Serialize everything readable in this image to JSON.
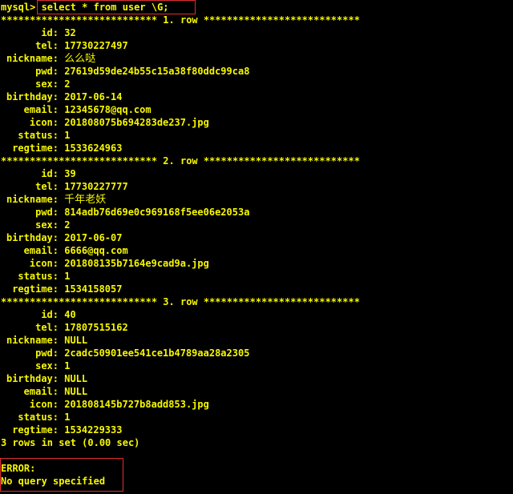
{
  "terminal": {
    "prompt": "mysql>",
    "command": " select * from user \\G;",
    "records": [
      {
        "separator": "*************************** 1. row ***************************",
        "fields": [
          {
            "label": "id:",
            "value": "32"
          },
          {
            "label": "tel:",
            "value": "17730227497"
          },
          {
            "label": "nickname:",
            "value": "么么哒",
            "cjk": true
          },
          {
            "label": "pwd:",
            "value": "27619d59de24b55c15a38f80ddc99ca8"
          },
          {
            "label": "sex:",
            "value": "2"
          },
          {
            "label": "birthday:",
            "value": "2017-06-14"
          },
          {
            "label": "email:",
            "value": "12345678@qq.com"
          },
          {
            "label": "icon:",
            "value": "201808075b694283de237.jpg"
          },
          {
            "label": "status:",
            "value": "1"
          },
          {
            "label": "regtime:",
            "value": "1533624963"
          }
        ]
      },
      {
        "separator": "*************************** 2. row ***************************",
        "fields": [
          {
            "label": "id:",
            "value": "39"
          },
          {
            "label": "tel:",
            "value": "17730227777"
          },
          {
            "label": "nickname:",
            "value": "千年老妖",
            "cjk": true
          },
          {
            "label": "pwd:",
            "value": "814adb76d69e0c969168f5ee06e2053a"
          },
          {
            "label": "sex:",
            "value": "2"
          },
          {
            "label": "birthday:",
            "value": "2017-06-07"
          },
          {
            "label": "email:",
            "value": "6666@qq.com"
          },
          {
            "label": "icon:",
            "value": "201808135b7164e9cad9a.jpg"
          },
          {
            "label": "status:",
            "value": "1"
          },
          {
            "label": "regtime:",
            "value": "1534158057"
          }
        ]
      },
      {
        "separator": "*************************** 3. row ***************************",
        "fields": [
          {
            "label": "id:",
            "value": "40"
          },
          {
            "label": "tel:",
            "value": "17807515162"
          },
          {
            "label": "nickname:",
            "value": "NULL"
          },
          {
            "label": "pwd:",
            "value": "2cadc50901ee541ce1b4789aa28a2305"
          },
          {
            "label": "sex:",
            "value": "1"
          },
          {
            "label": "birthday:",
            "value": "NULL"
          },
          {
            "label": "email:",
            "value": "NULL"
          },
          {
            "label": "icon:",
            "value": "201808145b727b8add853.jpg"
          },
          {
            "label": "status:",
            "value": "1"
          },
          {
            "label": "regtime:",
            "value": "1534229333"
          }
        ]
      }
    ],
    "summary": "3 rows in set (0.00 sec)",
    "error_title": "ERROR:",
    "error_message": "No query specified"
  },
  "colors": {
    "text": "#f7f700",
    "background": "#000000",
    "highlight_box": "#e03030"
  }
}
